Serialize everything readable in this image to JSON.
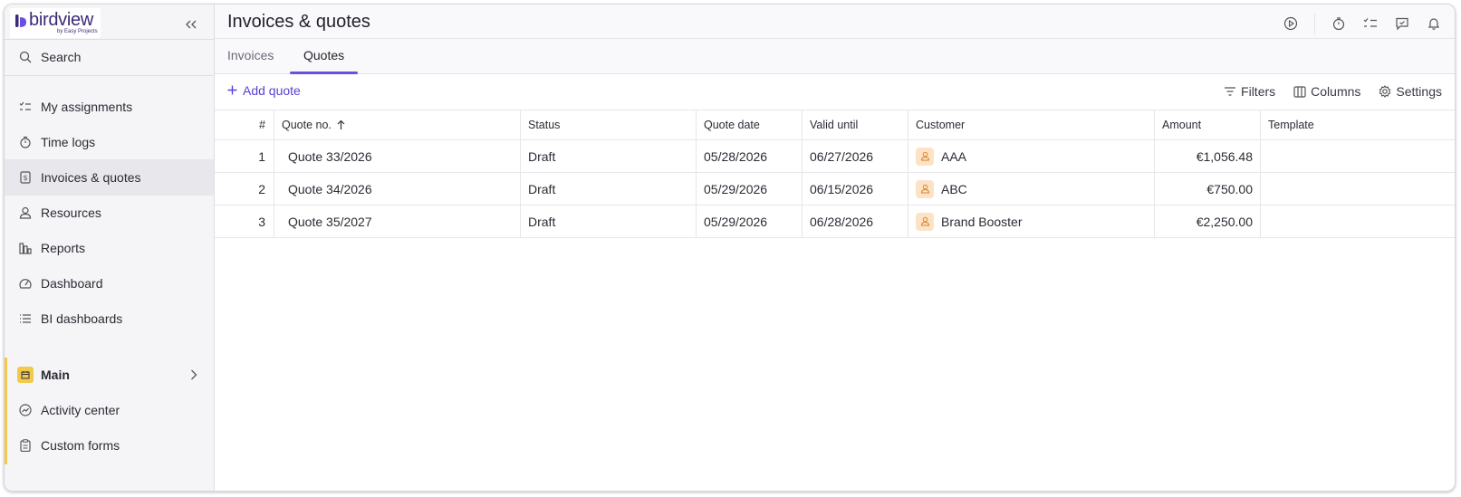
{
  "app": {
    "logo_text": "birdview",
    "logo_sub": "by Easy Projects"
  },
  "sidebar": {
    "search_label": "Search",
    "items": [
      {
        "label": "My assignments",
        "icon": "checklist-icon"
      },
      {
        "label": "Time logs",
        "icon": "stopwatch-icon"
      },
      {
        "label": "Invoices & quotes",
        "icon": "invoice-icon",
        "active": true
      },
      {
        "label": "Resources",
        "icon": "person-icon"
      },
      {
        "label": "Reports",
        "icon": "bar-chart-icon"
      },
      {
        "label": "Dashboard",
        "icon": "gauge-icon"
      },
      {
        "label": "BI dashboards",
        "icon": "list-icon"
      }
    ],
    "section": {
      "label": "Main",
      "color": "#f3c94c"
    },
    "section_items": [
      {
        "label": "Activity center",
        "icon": "activity-icon"
      },
      {
        "label": "Custom forms",
        "icon": "clipboard-icon"
      }
    ]
  },
  "header": {
    "title": "Invoices & quotes"
  },
  "tabs": [
    {
      "label": "Invoices",
      "active": false
    },
    {
      "label": "Quotes",
      "active": true
    }
  ],
  "toolbar": {
    "add_label": "Add quote",
    "filters_label": "Filters",
    "columns_label": "Columns",
    "settings_label": "Settings"
  },
  "table": {
    "columns": [
      "#",
      "Quote no.",
      "Status",
      "Quote date",
      "Valid until",
      "Customer",
      "Amount",
      "Template"
    ],
    "rows": [
      {
        "num": "1",
        "quote_no": "Quote 33/2026",
        "status": "Draft",
        "quote_date": "05/28/2026",
        "valid_until": "06/27/2026",
        "customer": "AAA",
        "amount": "€1,056.48",
        "template": ""
      },
      {
        "num": "2",
        "quote_no": "Quote 34/2026",
        "status": "Draft",
        "quote_date": "05/29/2026",
        "valid_until": "06/15/2026",
        "customer": "ABC",
        "amount": "€750.00",
        "template": ""
      },
      {
        "num": "3",
        "quote_no": "Quote 35/2027",
        "status": "Draft",
        "quote_date": "05/29/2026",
        "valid_until": "06/28/2026",
        "customer": "Brand Booster",
        "amount": "€2,250.00",
        "template": ""
      }
    ]
  },
  "colors": {
    "accent": "#5b3fd6",
    "brand": "#3c2a77",
    "section": "#f3c94c",
    "customer_badge": "#fde3c6"
  }
}
